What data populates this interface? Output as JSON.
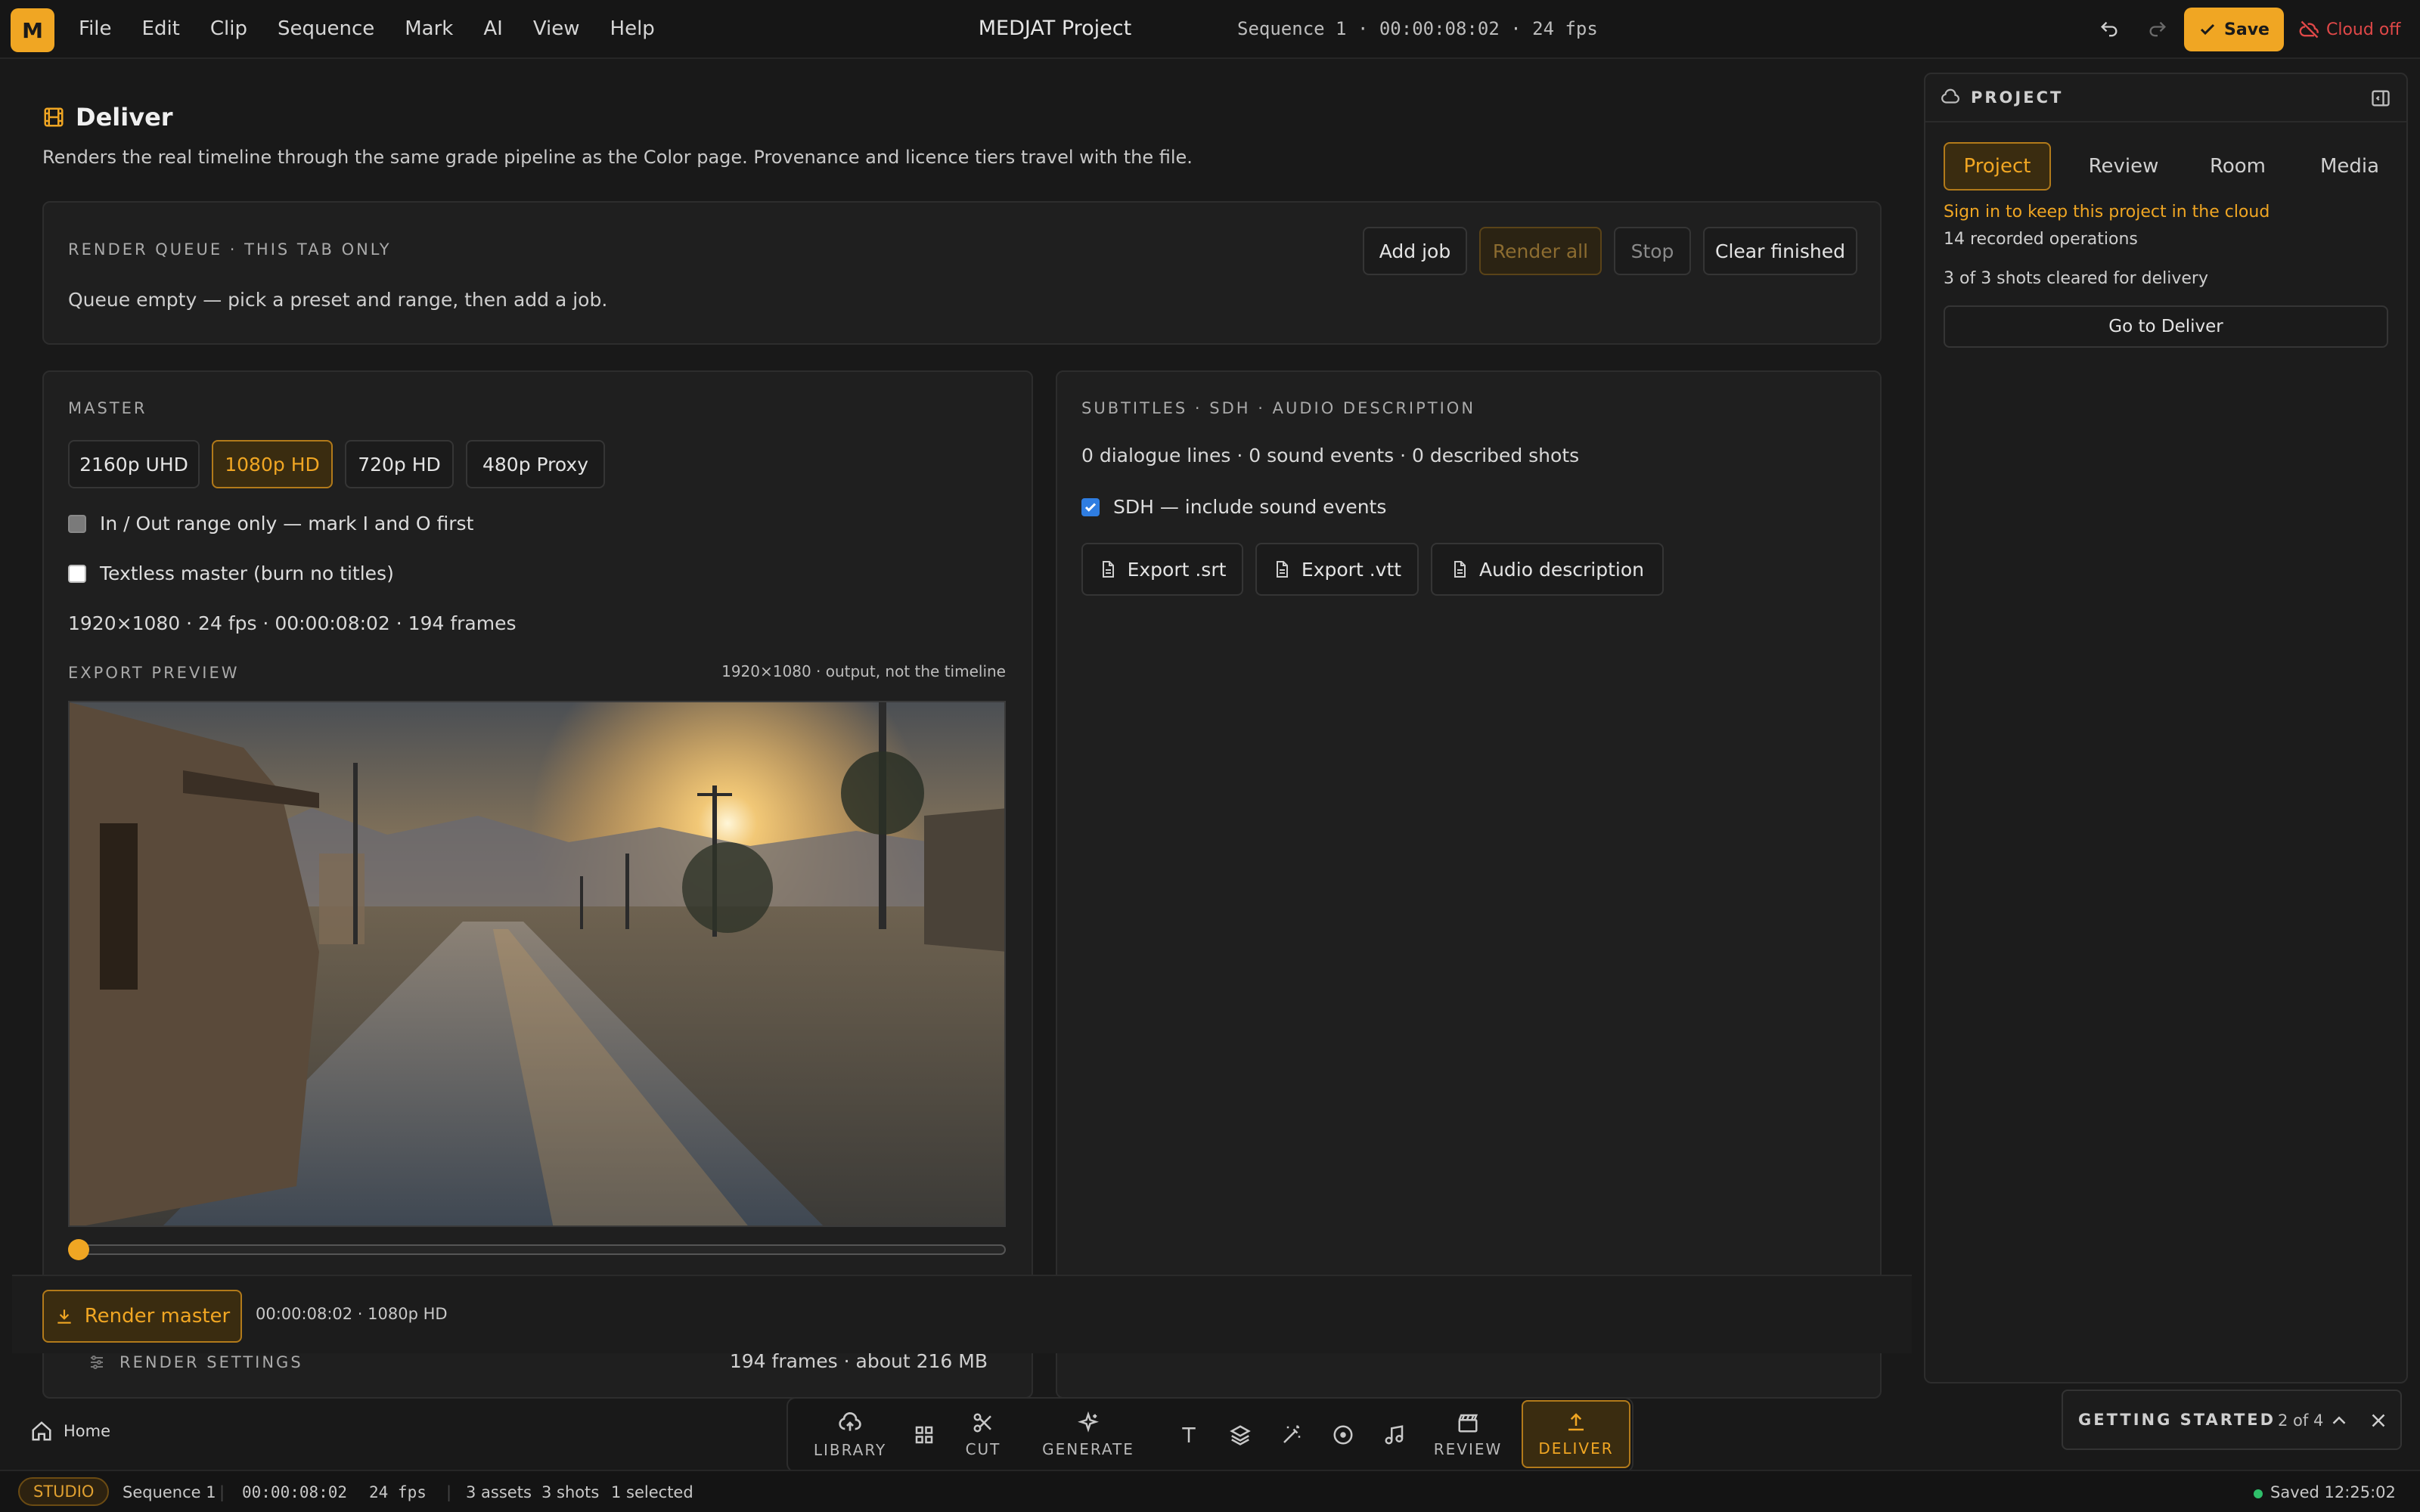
{
  "app": {
    "logo_letter": "M",
    "title": "MEDJAT Project",
    "sequence_info": "Sequence 1 · 00:00:08:02 · 24 fps",
    "menus": [
      "File",
      "Edit",
      "Clip",
      "Sequence",
      "Mark",
      "AI",
      "View",
      "Help"
    ],
    "save_label": "Save",
    "cloud_label": "Cloud off",
    "accent": "#f0a623",
    "danger": "#e04848"
  },
  "deliver": {
    "title": "Deliver",
    "subtitle": "Renders the real timeline through the same grade pipeline as the Color page. Provenance and licence tiers travel with the file."
  },
  "queue": {
    "caption": "RENDER QUEUE · THIS TAB ONLY",
    "empty_text": "Queue empty — pick a preset and range, then add a job.",
    "add_job": "Add job",
    "render_all": "Render all",
    "stop": "Stop",
    "clear_finished": "Clear finished"
  },
  "master": {
    "caption": "MASTER",
    "presets": [
      "2160p UHD",
      "1080p HD",
      "720p HD",
      "480p Proxy"
    ],
    "selected_preset": "1080p HD",
    "in_out_label": "In / Out range only — mark I and O first",
    "in_out_checked": false,
    "textless_label": "Textless master (burn no titles)",
    "textless_checked": false,
    "summary": "1920×1080 · 24 fps · 00:00:08:02 · 194 frames",
    "preview_caption": "EXPORT PREVIEW",
    "preview_note": "1920×1080 · output, not the timeline",
    "scrub_position": 0,
    "render_settings": "RENDER SETTINGS",
    "render_estimate": "194 frames · about 216 MB"
  },
  "subtitles": {
    "caption": "SUBTITLES · SDH · AUDIO DESCRIPTION",
    "summary": "0 dialogue lines · 0 sound events · 0 described shots",
    "sdh_label": "SDH — include sound events",
    "sdh_checked": true,
    "export_srt": "Export .srt",
    "export_vtt": "Export .vtt",
    "audio_description": "Audio description"
  },
  "render_bar": {
    "button": "Render master",
    "info": "00:00:08:02 · 1080p HD"
  },
  "project_panel": {
    "title": "PROJECT",
    "tabs": [
      "Project",
      "Review",
      "Room",
      "Media"
    ],
    "active_tab": "Project",
    "signin_text": "Sign in to keep this project in the cloud",
    "operations": "14 recorded operations",
    "cleared": "3 of 3 shots cleared for delivery",
    "go_deliver": "Go to Deliver"
  },
  "dock": {
    "library": "LIBRARY",
    "cut": "CUT",
    "generate": "GENERATE",
    "review": "REVIEW",
    "deliver": "DELIVER"
  },
  "getting_started": {
    "title": "GETTING STARTED",
    "progress": "2 of 4"
  },
  "status": {
    "home": "Home",
    "mode": "STUDIO",
    "sequence": "Sequence 1",
    "timecode": "00:00:08:02",
    "fps": "24 fps",
    "assets": "3 assets",
    "shots": "3 shots",
    "selected": "1 selected",
    "saved": "Saved 12:25:02 PM"
  }
}
